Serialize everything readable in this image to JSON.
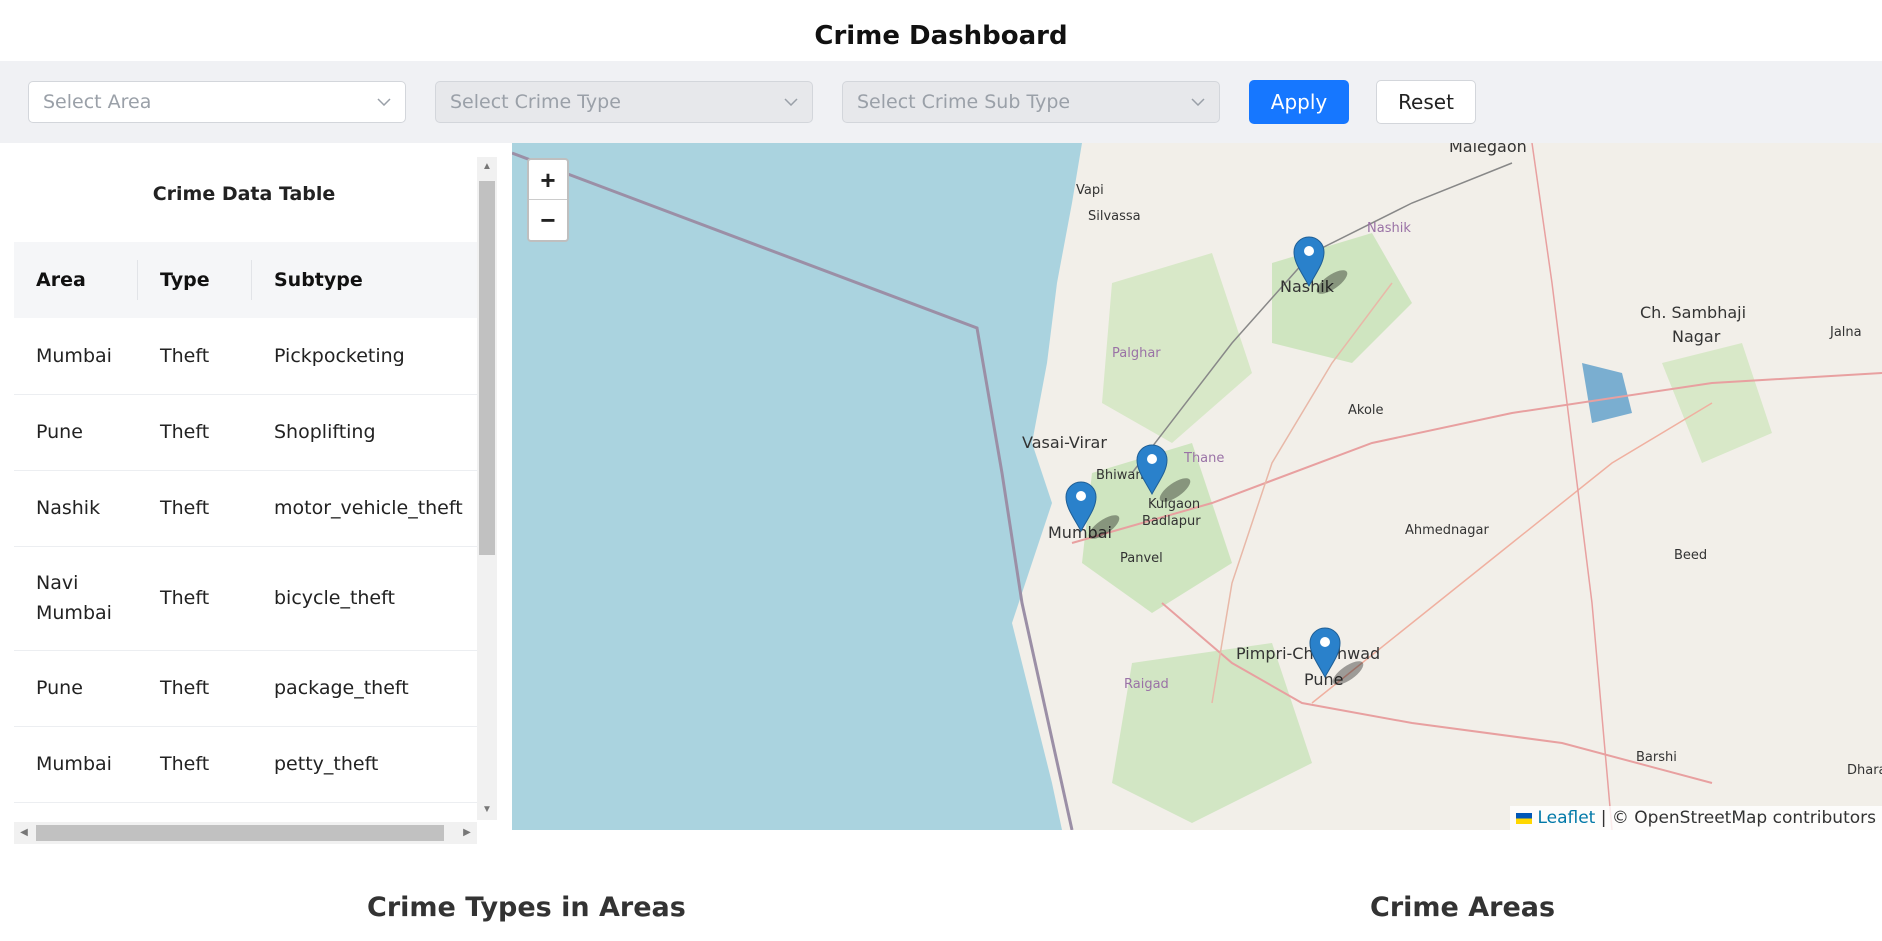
{
  "app": {
    "title": "Crime Dashboard"
  },
  "filters": {
    "area_placeholder": "Select Area",
    "type_placeholder": "Select Crime Type",
    "subtype_placeholder": "Select Crime Sub Type",
    "apply_label": "Apply",
    "reset_label": "Reset"
  },
  "table": {
    "title": "Crime Data Table",
    "columns": [
      "Area",
      "Type",
      "Subtype"
    ],
    "rows": [
      [
        "Mumbai",
        "Theft",
        "Pickpocketing"
      ],
      [
        "Pune",
        "Theft",
        "Shoplifting"
      ],
      [
        "Nashik",
        "Theft",
        "motor_vehicle_theft"
      ],
      [
        "Navi Mumbai",
        "Theft",
        "bicycle_theft"
      ],
      [
        "Pune",
        "Theft",
        "package_theft"
      ],
      [
        "Mumbai",
        "Theft",
        "petty_theft"
      ]
    ]
  },
  "map": {
    "zoom_in": "+",
    "zoom_out": "−",
    "attribution_leaflet": "Leaflet",
    "attribution_rest": " | © OpenStreetMap contributors",
    "labels": {
      "malegaon": "Malegaon",
      "vapi": "Vapi",
      "silvassa": "Silvassa",
      "nashik_region": "Nashik",
      "nashik": "Nashik",
      "sambhaji": "Ch. Sambhaji",
      "nagar": "Nagar",
      "jalna": "Jalna",
      "palghar": "Palghar",
      "akole": "Akole",
      "vasai": "Vasai-Virar",
      "bhiwandi": "Bhiwandi",
      "thane": "Thane",
      "kulgaon": "Kulgaon",
      "badlapur": "Badlapur",
      "mumbai": "Mumbai",
      "panvel": "Panvel",
      "ahmednagar": "Ahmednagar",
      "beed": "Beed",
      "pimpri": "Pimpri-Chinchwad",
      "pune": "Pune",
      "raigad": "Raigad",
      "barshi": "Barshi",
      "dharashiv": "Dhara"
    },
    "colors": {
      "water": "#aad3df",
      "land": "#f2efe9",
      "marker": "#2a81cb"
    }
  },
  "sections": {
    "crime_types": "Crime Types in Areas",
    "crime_areas": "Crime Areas"
  }
}
